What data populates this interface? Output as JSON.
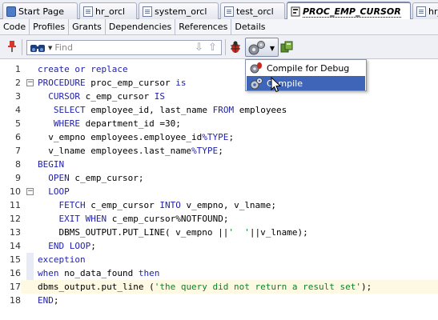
{
  "tabs": [
    {
      "label": "Start Page",
      "icon": "home-icon"
    },
    {
      "label": "hr_orcl",
      "icon": "sql-worksheet-icon"
    },
    {
      "label": "system_orcl",
      "icon": "sql-worksheet-icon"
    },
    {
      "label": "test_orcl",
      "icon": "sql-worksheet-icon"
    },
    {
      "label": "PROC_EMP_CURSOR",
      "icon": "procedure-icon",
      "active": true
    },
    {
      "label": "hr_",
      "icon": "sql-worksheet-icon"
    }
  ],
  "subtabs": [
    "Code",
    "Profiles",
    "Grants",
    "Dependencies",
    "References",
    "Details"
  ],
  "toolbar": {
    "find_placeholder": "Find",
    "icons": [
      "pin-icon",
      "binoculars-icon",
      "find-next-icon",
      "find-previous-icon",
      "debug-icon",
      "compile-gear-icon",
      "run-icon"
    ]
  },
  "popup": {
    "items": [
      {
        "label": "Compile for Debug",
        "icon": "compile-debug-icon"
      },
      {
        "label": "Compile",
        "icon": "compile-icon",
        "selected": true
      }
    ]
  },
  "colors": {
    "keyword": "#1f1fa8",
    "string": "#0f7f2a",
    "selection": "#3e65b8",
    "current_line": "#fdf9e3"
  },
  "code": [
    {
      "n": "1",
      "t": "create or replace"
    },
    {
      "n": "2",
      "t": "PROCEDURE proc_emp_cursor is"
    },
    {
      "n": "3",
      "t": "  CURSOR c_emp_cursor IS"
    },
    {
      "n": "4",
      "t": "   SELECT employee_id, last_name FROM employees"
    },
    {
      "n": "5",
      "t": "   WHERE department_id =30;"
    },
    {
      "n": "6",
      "t": "  v_empno employees.employee_id%TYPE;"
    },
    {
      "n": "7",
      "t": "  v_lname employees.last_name%TYPE;"
    },
    {
      "n": "8",
      "t": "BEGIN"
    },
    {
      "n": "9",
      "t": "  OPEN c_emp_cursor;"
    },
    {
      "n": "10",
      "t": "  LOOP"
    },
    {
      "n": "11",
      "t": "    FETCH c_emp_cursor INTO v_empno, v_lname;"
    },
    {
      "n": "12",
      "t": "    EXIT WHEN c_emp_cursor%NOTFOUND;"
    },
    {
      "n": "13",
      "t": "    DBMS_OUTPUT.PUT_LINE( v_empno ||'  '||v_lname);"
    },
    {
      "n": "14",
      "t": "  END LOOP;"
    },
    {
      "n": "15",
      "t": "exception"
    },
    {
      "n": "16",
      "t": "when no_data_found then"
    },
    {
      "n": "17",
      "t": "dbms_output.put_line ('the query did not return a result set');"
    },
    {
      "n": "18",
      "t": "END;"
    }
  ]
}
